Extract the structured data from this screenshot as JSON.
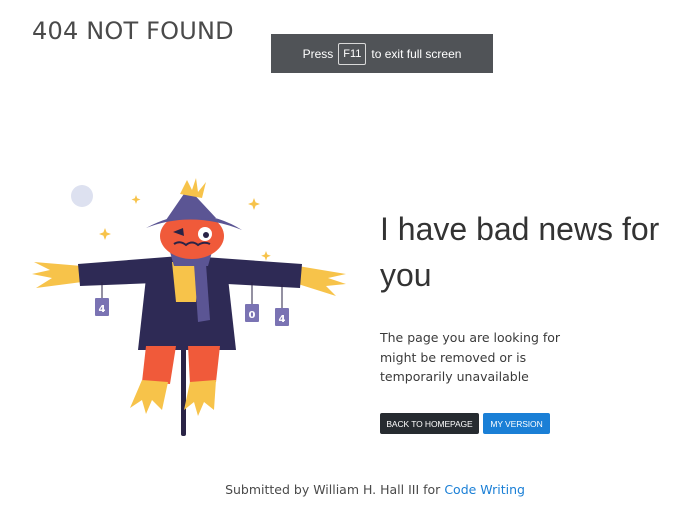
{
  "site_title": "404 NOT FOUND",
  "fullscreen_notice": {
    "prefix": "Press",
    "key": "F11",
    "suffix": "to exit full screen"
  },
  "illustration": {
    "tin_can_labels": [
      "4",
      "0",
      "4"
    ]
  },
  "headline": "I have bad news for you",
  "message": "The page you are looking for might be removed or is temporarily unavailable",
  "buttons": {
    "home": "BACK TO HOMEPAGE",
    "version": "MY VERSION"
  },
  "footer": {
    "text": "Submitted by William H. Hall III for",
    "link": "Code Writing"
  },
  "colors": {
    "accent_blue": "#1a7fd6",
    "dark_button": "#262b30",
    "hat_purple": "#5b5594",
    "coat_navy": "#2e2a55",
    "face_orange": "#f05a3a",
    "straw_yellow": "#f7c34a"
  }
}
